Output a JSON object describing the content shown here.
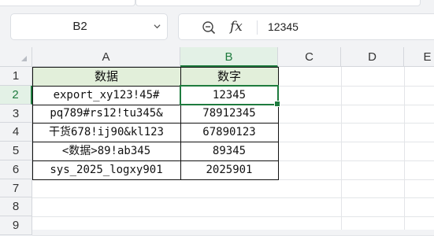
{
  "formula_bar": {
    "cell_ref": "B2",
    "fx_label": "fx",
    "value": "12345"
  },
  "columns": [
    "A",
    "B",
    "C",
    "D",
    "E"
  ],
  "rows": [
    "1",
    "2",
    "3",
    "4",
    "5",
    "6",
    "7",
    "8",
    "9"
  ],
  "active_cell": {
    "column": "B",
    "row": "2"
  },
  "cells": {
    "A1": "数据",
    "B1": "数字",
    "A2": "export_xy123!45#",
    "B2": "12345",
    "A3": "pq789#rs12!tu345&",
    "B3": "78912345",
    "A4": "干货678!ij90&kl123",
    "B4": "67890123",
    "A5": "<数据>89!ab345",
    "B5": "89345",
    "A6": "sys_2025_logxy901",
    "B6": "2025901"
  },
  "colors": {
    "accent": "#1e7b3e",
    "header_fill": "#e2efda"
  },
  "icons": [
    "chevron-down-icon",
    "zoom-icon",
    "fx-icon",
    "select-all-icon"
  ]
}
